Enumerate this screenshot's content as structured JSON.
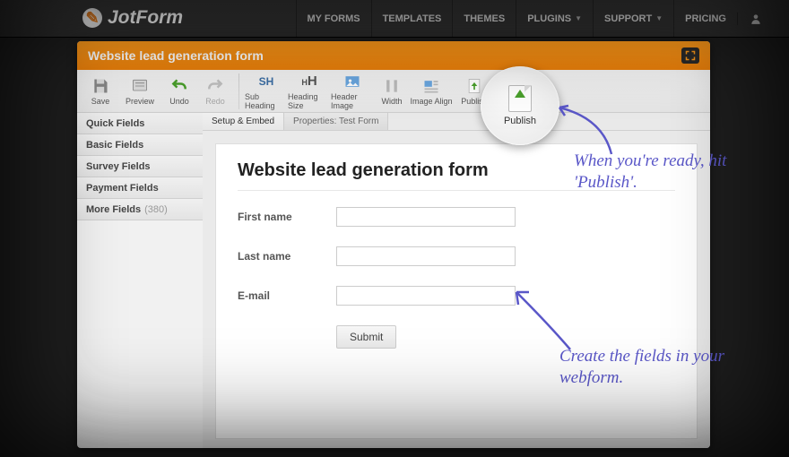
{
  "brand": {
    "name": "JotForm"
  },
  "nav": {
    "items": [
      "MY FORMS",
      "TEMPLATES",
      "THEMES",
      "PLUGINS",
      "SUPPORT",
      "PRICING"
    ],
    "dropdown_flags": [
      false,
      false,
      false,
      true,
      true,
      false
    ]
  },
  "titlebar": {
    "title": "Website lead generation form"
  },
  "toolbar": {
    "left": [
      {
        "name": "save",
        "label": "Save"
      },
      {
        "name": "preview",
        "label": "Preview"
      },
      {
        "name": "undo",
        "label": "Undo"
      },
      {
        "name": "redo",
        "label": "Redo",
        "disabled": true
      }
    ],
    "right": [
      {
        "name": "sub-heading",
        "label": "Sub Heading"
      },
      {
        "name": "heading-size",
        "label": "Heading Size"
      },
      {
        "name": "header-image",
        "label": "Header Image"
      },
      {
        "name": "width",
        "label": "Width"
      },
      {
        "name": "image-align",
        "label": "Image Align"
      },
      {
        "name": "publish",
        "label": "Publish"
      }
    ]
  },
  "sidebar": {
    "items": [
      {
        "label": "Quick Fields"
      },
      {
        "label": "Basic Fields"
      },
      {
        "label": "Survey Fields"
      },
      {
        "label": "Payment Fields"
      },
      {
        "label": "More Fields",
        "count": "(380)"
      }
    ]
  },
  "tabs": {
    "items": [
      "Setup & Embed",
      "Properties: Test Form"
    ],
    "active_index": 0
  },
  "form": {
    "title": "Website lead generation form",
    "fields": [
      {
        "label": "First name"
      },
      {
        "label": "Last name"
      },
      {
        "label": "E-mail"
      }
    ],
    "submit_label": "Submit"
  },
  "lens": {
    "label": "Publish"
  },
  "annotations": {
    "hand1": "When you're ready, hit 'Publish'.",
    "hand2": "Create the fields in your webform."
  }
}
